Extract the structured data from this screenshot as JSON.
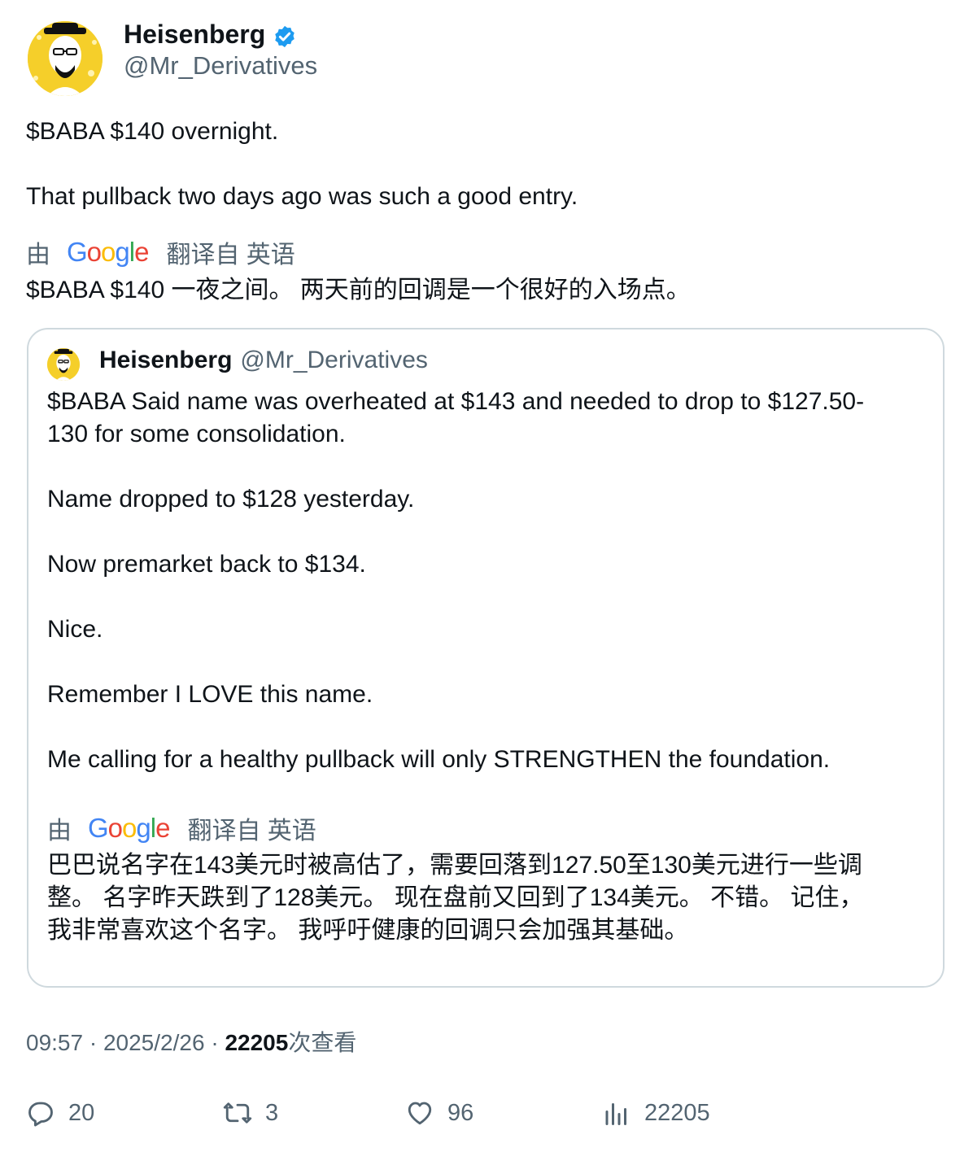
{
  "author": {
    "name": "Heisenberg",
    "handle": "@Mr_Derivatives",
    "verified": true,
    "avatar": "heisenberg-avatar"
  },
  "tweet": {
    "line1": "$BABA $140 overnight.",
    "line2": "That pullback two days ago was such a good entry.",
    "translation": {
      "by": "由",
      "from_label": "翻译自 英语",
      "text": "$BABA $140 一夜之间。 两天前的回调是一个很好的入场点。"
    }
  },
  "quoted": {
    "name": "Heisenberg",
    "handle": "@Mr_Derivatives",
    "lines": [
      "$BABA Said name was overheated at $143 and needed to drop to $127.50-",
      "130 for some consolidation.",
      "Name dropped to $128 yesterday.",
      "Now premarket back to $134.",
      "Nice.",
      "Remember I LOVE this name.",
      "Me calling for a healthy pullback will only STRENGTHEN the foundation."
    ],
    "translation": {
      "by": "由",
      "from_label": "翻译自 英语",
      "lines": [
        "巴巴说名字在143美元时被高估了，需要回落到127.50至130美元进行一些调",
        "整。 名字昨天跌到了128美元。 现在盘前又回到了134美元。 不错。 记住，",
        "我非常喜欢这个名字。 我呼吁健康的回调只会加强其基础。"
      ]
    }
  },
  "meta": {
    "time": "09:57",
    "date": "2025/2/26",
    "views_count": "22205",
    "views_label": "次查看"
  },
  "actions": {
    "replies": "20",
    "reposts": "3",
    "likes": "96",
    "views": "22205"
  },
  "colors": {
    "text": "#0f1419",
    "secondary": "#536471",
    "verified": "#1d9bf0",
    "border": "#cfd9de"
  }
}
